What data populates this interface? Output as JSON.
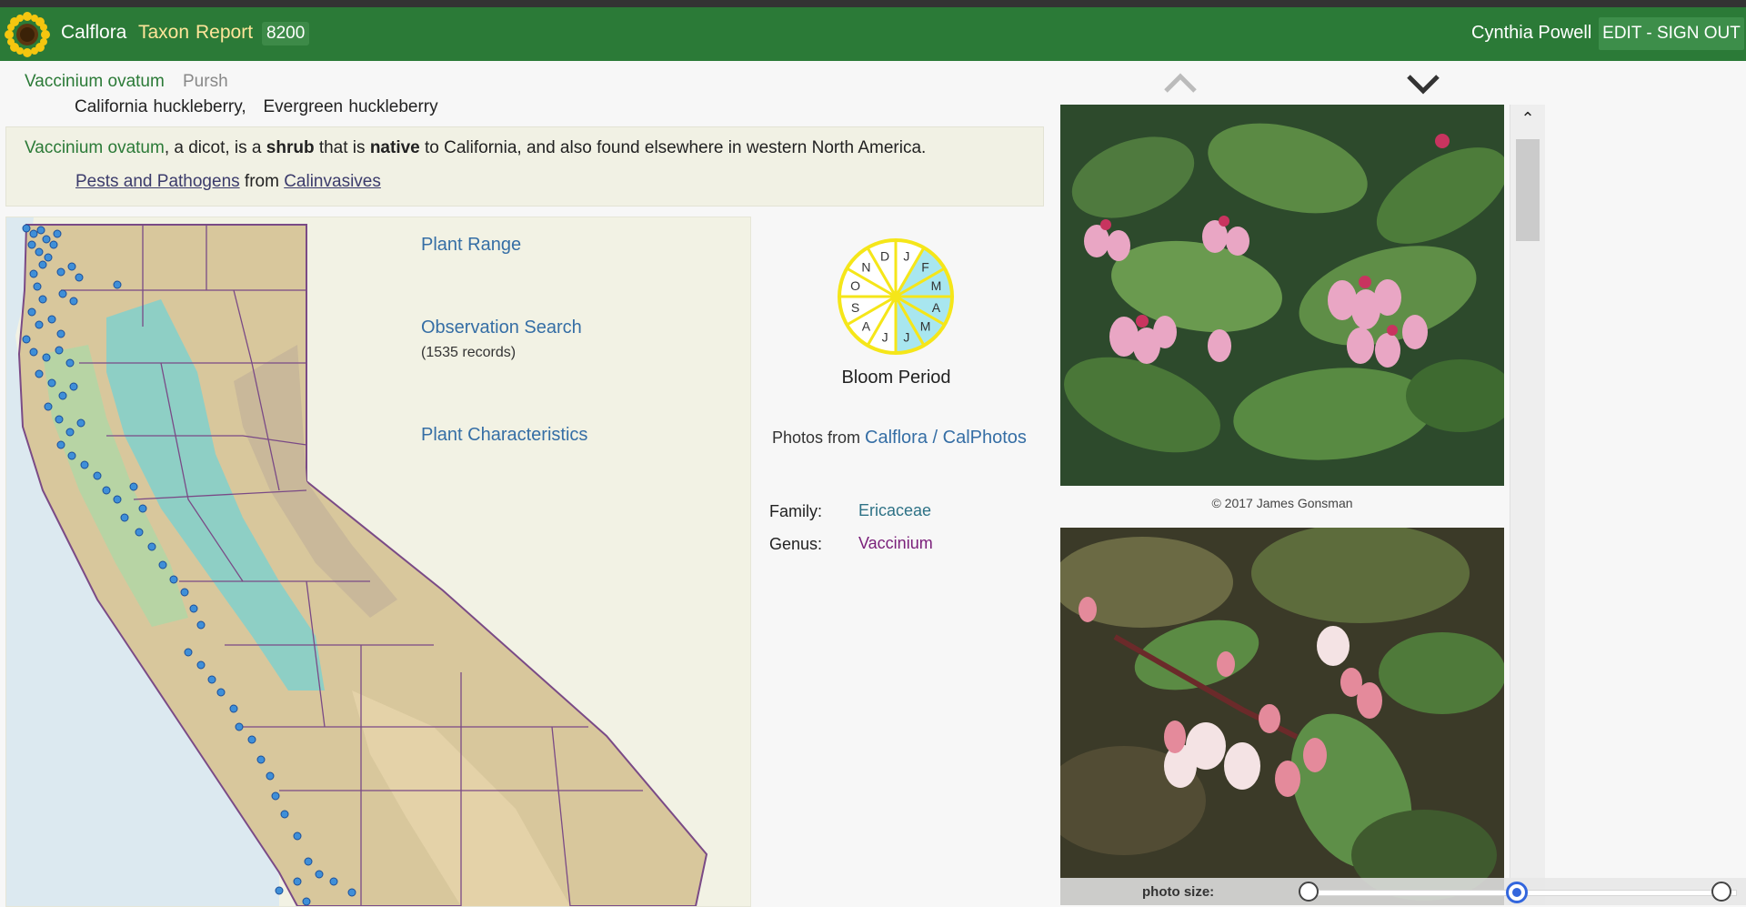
{
  "header": {
    "brand": "Calflora",
    "taxon": "Taxon",
    "report": "Report",
    "number": "8200",
    "user": "Cynthia Powell",
    "signout": "EDIT - SIGN OUT",
    "color": "#2b7a37"
  },
  "taxon": {
    "scientific": "Vaccinium ovatum",
    "author": "Pursh",
    "common_names": "California huckleberry,   Evergreen huckleberry"
  },
  "summary": {
    "sci": "Vaccinium ovatum",
    "p1": ", a dicot, is a ",
    "shrub": "shrub",
    "p2": " that is ",
    "native": "native",
    "p3": " to California, and also found elsewhere in western North America.",
    "pests_link": "Pests and Pathogens",
    "pests_from": " from ",
    "pests_source": "Calinvasives"
  },
  "links": {
    "range": "Plant Range",
    "observation": "Observation Search",
    "records": "(1535 records)",
    "characteristics": "Plant Characteristics"
  },
  "bloom": {
    "label": "Bloom Period",
    "months": [
      "J",
      "F",
      "M",
      "A",
      "M",
      "J",
      "J",
      "A",
      "S",
      "O",
      "N",
      "D"
    ],
    "active": [
      1,
      2,
      3,
      4,
      5
    ]
  },
  "photos_from": {
    "prefix": "Photos from ",
    "calflora": "Calflora",
    "sep": " / ",
    "calphotos": "CalPhotos"
  },
  "classification": {
    "family_label": "Family:",
    "family": "Ericaceae",
    "genus_label": "Genus:",
    "genus": "Vaccinium"
  },
  "gallery": {
    "credit": "© 2017 James Gonsman",
    "photo_size_label": "photo size:",
    "photo_size_value": 0.5
  },
  "icons": {
    "up": "chevron-up-icon",
    "down": "chevron-down-icon",
    "logo": "sunflower-logo"
  }
}
